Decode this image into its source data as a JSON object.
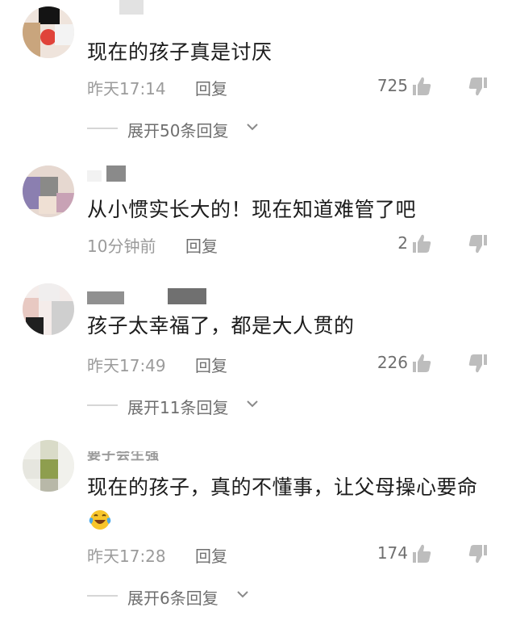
{
  "comments": [
    {
      "text": "现在的孩子真是讨厌",
      "time": "昨天17:14",
      "reply_label": "回复",
      "likes": "725",
      "expand_label": "展开50条回复",
      "avatar_colors": [
        "#141414",
        "#c9a57d",
        "#e0433a"
      ]
    },
    {
      "text": "从小惯实长大的！现在知道难管了吧",
      "time": "10分钟前",
      "reply_label": "回复",
      "likes": "2",
      "avatar_colors": [
        "#8b7fb0",
        "#c8a2b5",
        "#e6d8d0"
      ]
    },
    {
      "text": "孩子太幸福了，都是大人贯的",
      "time": "昨天17:49",
      "reply_label": "回复",
      "likes": "226",
      "expand_label": "展开11条回复",
      "avatar_colors": [
        "#e8c9c2",
        "#1f1f1f",
        "#f4ecea"
      ]
    },
    {
      "username": "要子会生强",
      "text": "现在的孩子，真的不懂事，让父母操心要命",
      "time": "昨天17:28",
      "reply_label": "回复",
      "likes": "174",
      "expand_label": "展开6条回复",
      "avatar_colors": [
        "#d9dbc8",
        "#8e9e4e",
        "#b8b8a8"
      ]
    }
  ],
  "colors": {
    "meta_text": "#9b9b9b",
    "action_text": "#6f6f6f",
    "divider": "#d6d6d6"
  },
  "icons": [
    "thumbs-up-icon",
    "thumbs-down-icon",
    "chevron-down-icon",
    "laughing-crying-emoji-icon"
  ]
}
